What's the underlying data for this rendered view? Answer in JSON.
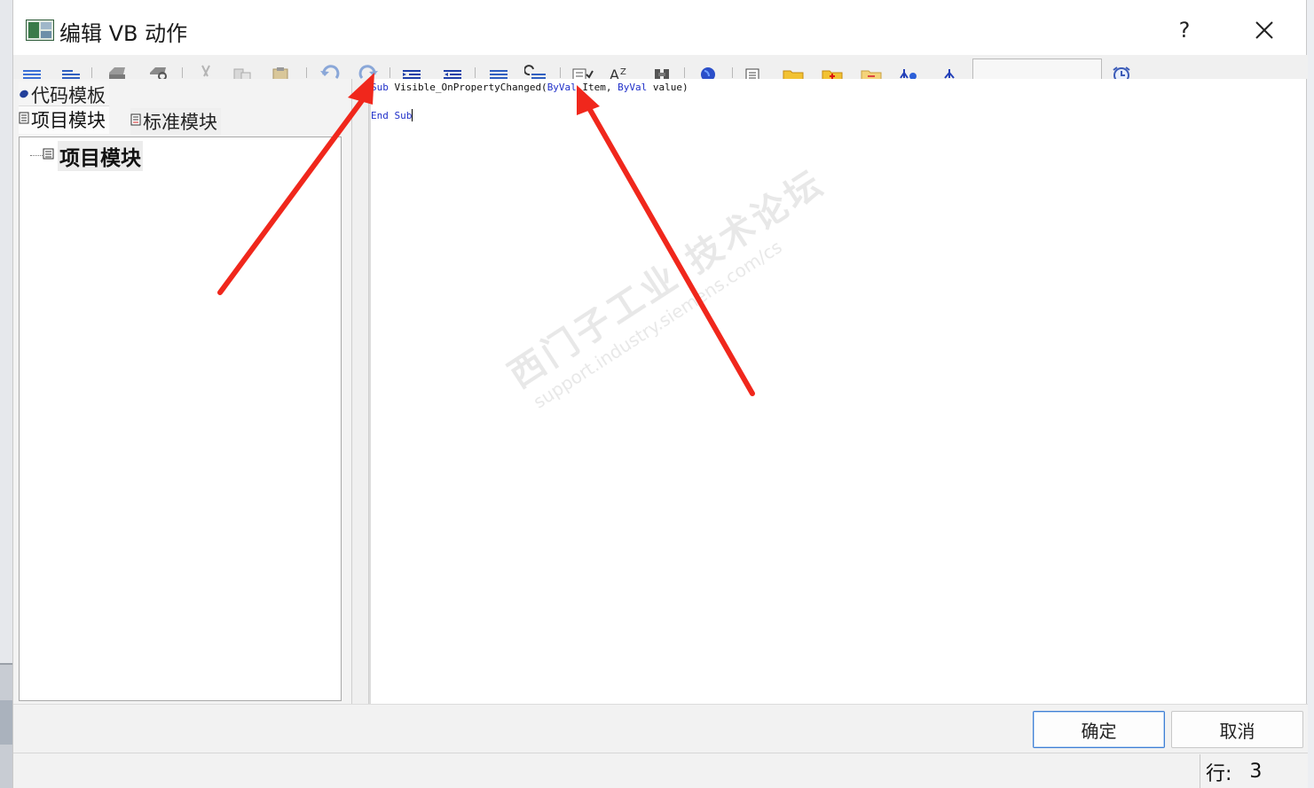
{
  "window": {
    "title": "编辑 VB 动作",
    "help_label": "?"
  },
  "toolbar": {
    "icons": [
      "align-icon",
      "indent-icon",
      "print-icon",
      "print-preview-icon",
      "cut-icon",
      "copy-icon",
      "paste-icon",
      "undo-icon",
      "redo-icon",
      "increase-indent-icon",
      "decrease-indent-icon",
      "comment-icon",
      "uncomment-icon",
      "syntax-check-icon",
      "font-icon",
      "find-icon",
      "globe-icon",
      "document-icon",
      "folder-icon",
      "folder-add-icon",
      "folder-delete-icon",
      "tag-icon",
      "tag-select-icon",
      "clock-icon"
    ],
    "combo_value": ""
  },
  "left_panel": {
    "tab_template": "代码模板",
    "tab_project": "项目模块",
    "tab_standard": "标准模块",
    "tree_root": "项目模块"
  },
  "editor": {
    "line1": {
      "kw1": "Sub",
      "name": " Visible_OnPropertyChanged(",
      "kw2": "ByVal",
      "mid": " Item, ",
      "kw3": "ByVal",
      "tail": " value)"
    },
    "line3": {
      "kw1": "End",
      "sp": " ",
      "kw2": "Sub"
    }
  },
  "watermark": {
    "cn": "西门子工业  技术论坛",
    "url": "support.industry.siemens.com/cs"
  },
  "footer": {
    "ok_label": "确定",
    "cancel_label": "取消",
    "status_line_label": "行:",
    "status_line_value": "3"
  },
  "colors": {
    "keyword": "#1f2fc9",
    "arrow": "#f0271c",
    "ok_border": "#3f7fd4"
  }
}
